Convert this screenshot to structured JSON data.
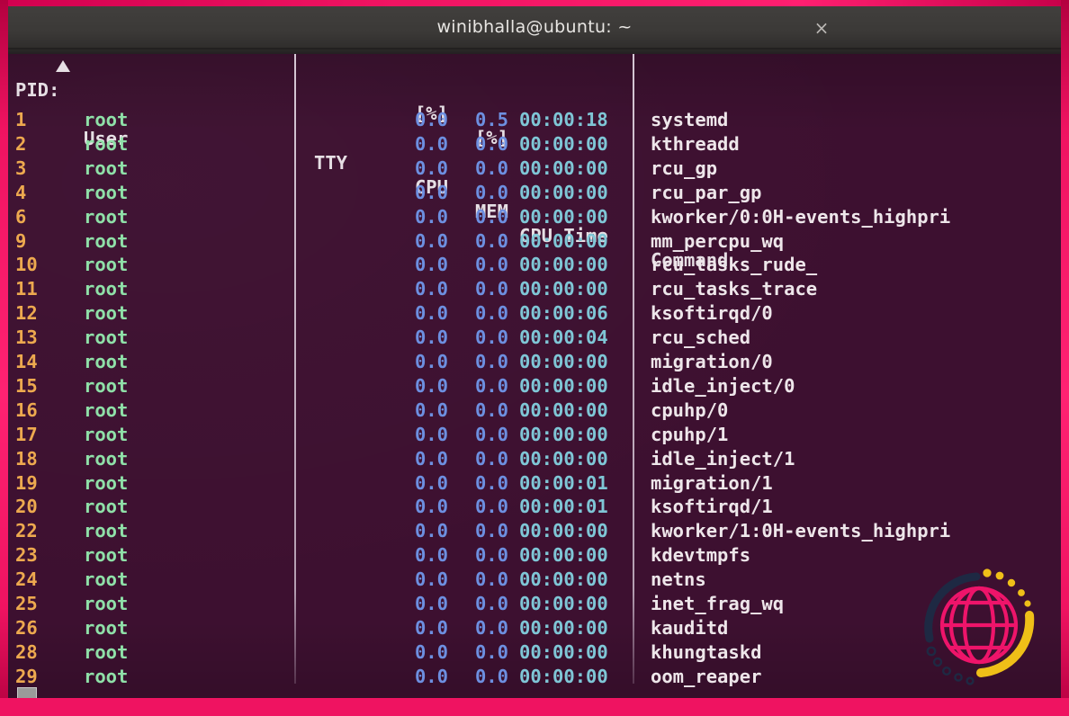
{
  "window": {
    "title": "winibhalla@ubuntu: ~",
    "close_label": "×",
    "close_icon": "close-icon"
  },
  "theme": {
    "frame_pink": "#ef1361",
    "terminal_bg": "#3d1030",
    "titlebar_bg": "#3b3937",
    "accent_orange": "#e8613a",
    "pid_color": "#eda94f",
    "user_color": "#8fe0a8",
    "number_color": "#6d8fe0",
    "time_color": "#7fc6d6",
    "command_color": "#eee6ea"
  },
  "table": {
    "headers": {
      "pid": "PID:",
      "sort_indicator": "ascending-triangle",
      "user": "User",
      "tty": "TTY",
      "cpu": "CPU",
      "cpu_unit": "[%]",
      "mem": "MEM",
      "mem_unit": "[%]",
      "cputime": "CPU Time",
      "command": "Command"
    },
    "rows": [
      {
        "pid": "1",
        "user": "root",
        "tty": "",
        "cpu": "0.0",
        "mem": "0.5",
        "time": "00:00:18",
        "command": "systemd"
      },
      {
        "pid": "2",
        "user": "root",
        "tty": "",
        "cpu": "0.0",
        "mem": "0.0",
        "time": "00:00:00",
        "command": "kthreadd"
      },
      {
        "pid": "3",
        "user": "root",
        "tty": "",
        "cpu": "0.0",
        "mem": "0.0",
        "time": "00:00:00",
        "command": "rcu_gp"
      },
      {
        "pid": "4",
        "user": "root",
        "tty": "",
        "cpu": "0.0",
        "mem": "0.0",
        "time": "00:00:00",
        "command": "rcu_par_gp"
      },
      {
        "pid": "6",
        "user": "root",
        "tty": "",
        "cpu": "0.0",
        "mem": "0.0",
        "time": "00:00:00",
        "command": "kworker/0:0H-events_highpri"
      },
      {
        "pid": "9",
        "user": "root",
        "tty": "",
        "cpu": "0.0",
        "mem": "0.0",
        "time": "00:00:00",
        "command": "mm_percpu_wq"
      },
      {
        "pid": "10",
        "user": "root",
        "tty": "",
        "cpu": "0.0",
        "mem": "0.0",
        "time": "00:00:00",
        "command": "rcu_tasks_rude_"
      },
      {
        "pid": "11",
        "user": "root",
        "tty": "",
        "cpu": "0.0",
        "mem": "0.0",
        "time": "00:00:00",
        "command": "rcu_tasks_trace"
      },
      {
        "pid": "12",
        "user": "root",
        "tty": "",
        "cpu": "0.0",
        "mem": "0.0",
        "time": "00:00:06",
        "command": "ksoftirqd/0"
      },
      {
        "pid": "13",
        "user": "root",
        "tty": "",
        "cpu": "0.0",
        "mem": "0.0",
        "time": "00:00:04",
        "command": "rcu_sched"
      },
      {
        "pid": "14",
        "user": "root",
        "tty": "",
        "cpu": "0.0",
        "mem": "0.0",
        "time": "00:00:00",
        "command": "migration/0"
      },
      {
        "pid": "15",
        "user": "root",
        "tty": "",
        "cpu": "0.0",
        "mem": "0.0",
        "time": "00:00:00",
        "command": "idle_inject/0"
      },
      {
        "pid": "16",
        "user": "root",
        "tty": "",
        "cpu": "0.0",
        "mem": "0.0",
        "time": "00:00:00",
        "command": "cpuhp/0"
      },
      {
        "pid": "17",
        "user": "root",
        "tty": "",
        "cpu": "0.0",
        "mem": "0.0",
        "time": "00:00:00",
        "command": "cpuhp/1"
      },
      {
        "pid": "18",
        "user": "root",
        "tty": "",
        "cpu": "0.0",
        "mem": "0.0",
        "time": "00:00:00",
        "command": "idle_inject/1"
      },
      {
        "pid": "19",
        "user": "root",
        "tty": "",
        "cpu": "0.0",
        "mem": "0.0",
        "time": "00:00:01",
        "command": "migration/1"
      },
      {
        "pid": "20",
        "user": "root",
        "tty": "",
        "cpu": "0.0",
        "mem": "0.0",
        "time": "00:00:01",
        "command": "ksoftirqd/1"
      },
      {
        "pid": "22",
        "user": "root",
        "tty": "",
        "cpu": "0.0",
        "mem": "0.0",
        "time": "00:00:00",
        "command": "kworker/1:0H-events_highpri"
      },
      {
        "pid": "23",
        "user": "root",
        "tty": "",
        "cpu": "0.0",
        "mem": "0.0",
        "time": "00:00:00",
        "command": "kdevtmpfs"
      },
      {
        "pid": "24",
        "user": "root",
        "tty": "",
        "cpu": "0.0",
        "mem": "0.0",
        "time": "00:00:00",
        "command": "netns"
      },
      {
        "pid": "25",
        "user": "root",
        "tty": "",
        "cpu": "0.0",
        "mem": "0.0",
        "time": "00:00:00",
        "command": "inet_frag_wq"
      },
      {
        "pid": "26",
        "user": "root",
        "tty": "",
        "cpu": "0.0",
        "mem": "0.0",
        "time": "00:00:00",
        "command": "kauditd"
      },
      {
        "pid": "28",
        "user": "root",
        "tty": "",
        "cpu": "0.0",
        "mem": "0.0",
        "time": "00:00:00",
        "command": "khungtaskd"
      },
      {
        "pid": "29",
        "user": "root",
        "tty": "",
        "cpu": "0.0",
        "mem": "0.0",
        "time": "00:00:00",
        "command": "oom_reaper"
      }
    ]
  },
  "watermark": {
    "name": "globe-logo",
    "globe_color": "#f4156c",
    "arc_dark_color": "#1e2a44",
    "arc_yellow_color": "#f5c518"
  }
}
